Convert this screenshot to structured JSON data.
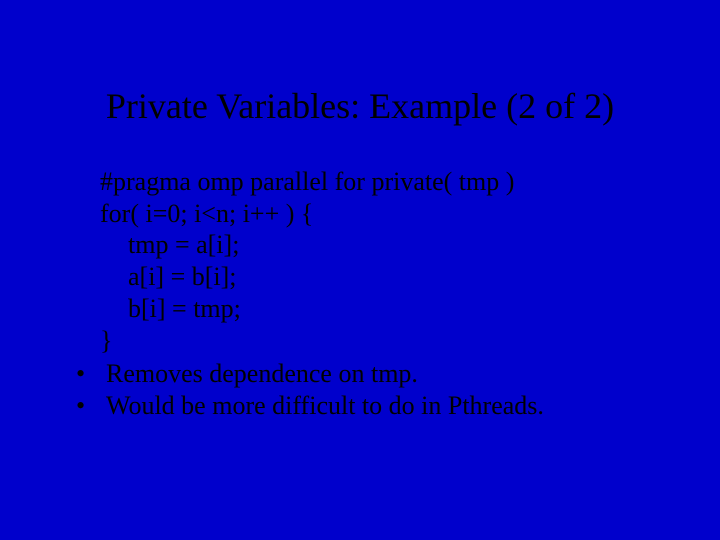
{
  "title": "Private Variables: Example (2 of 2)",
  "code": {
    "l1": "#pragma omp parallel for private( tmp )",
    "l2": "for( i=0; i<n; i++ ) {",
    "l3": "tmp = a[i];",
    "l4": "a[i] = b[i];",
    "l5": "b[i] = tmp;",
    "l6": "}"
  },
  "bullets": {
    "dot": "•",
    "b1": "Removes dependence on tmp.",
    "b2": "Would be more difficult to do in Pthreads."
  }
}
